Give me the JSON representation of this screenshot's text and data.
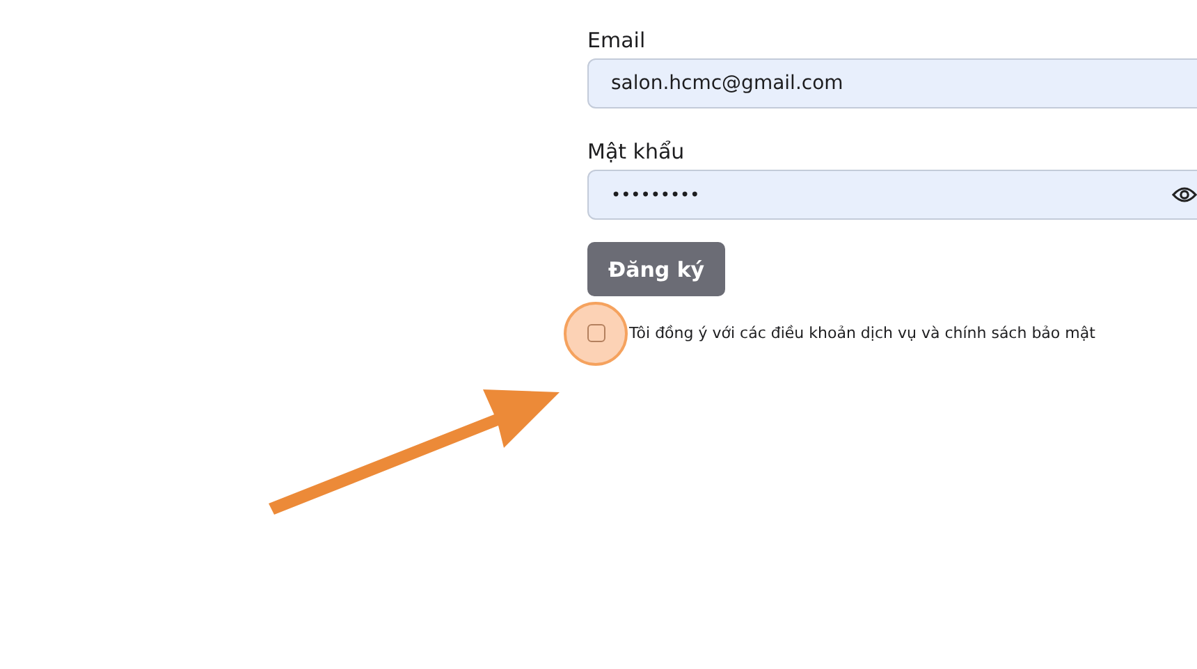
{
  "form": {
    "fields": [
      {
        "label": "Email",
        "kind": "text",
        "value": "salon.hcmc@gmail.com"
      },
      {
        "label": "Mật khẩu",
        "kind": "password",
        "value": "•••••••••"
      }
    ],
    "submit_button": "Đăng ký",
    "terms": {
      "label": "Tôi đồng ý với các điều khoản dịch vụ và chính sách bảo mật",
      "checked": false
    }
  }
}
